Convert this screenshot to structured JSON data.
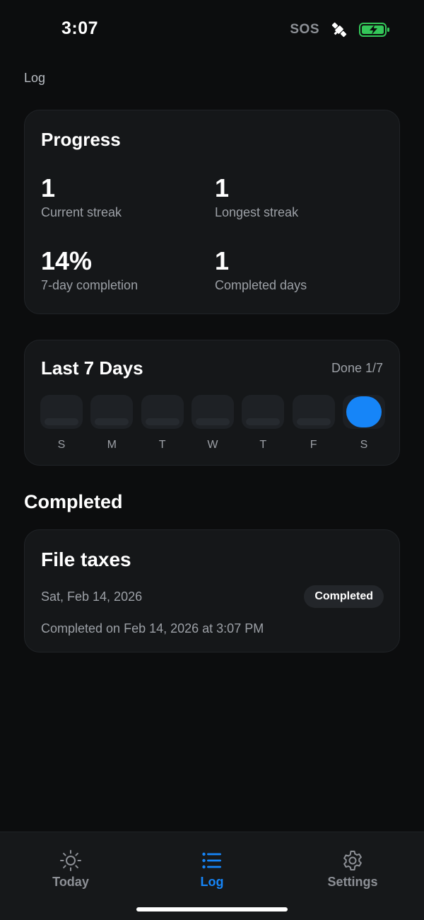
{
  "status_bar": {
    "time": "3:07",
    "sos": "SOS"
  },
  "nav": {
    "title": "Log"
  },
  "progress": {
    "title": "Progress",
    "stats": [
      {
        "value": "1",
        "label": "Current streak"
      },
      {
        "value": "1",
        "label": "Longest streak"
      },
      {
        "value": "14%",
        "label": "7-day completion"
      },
      {
        "value": "1",
        "label": "Completed days"
      }
    ]
  },
  "week": {
    "title": "Last 7 Days",
    "done_count": "Done 1/7",
    "days": [
      {
        "label": "S",
        "done": false
      },
      {
        "label": "M",
        "done": false
      },
      {
        "label": "T",
        "done": false
      },
      {
        "label": "W",
        "done": false
      },
      {
        "label": "T",
        "done": false
      },
      {
        "label": "F",
        "done": false
      },
      {
        "label": "S",
        "done": true
      }
    ]
  },
  "completed": {
    "section_title": "Completed",
    "items": [
      {
        "title": "File taxes",
        "date": "Sat, Feb 14, 2026",
        "badge": "Completed",
        "note": "Completed on Feb 14, 2026 at 3:07 PM"
      }
    ]
  },
  "tabs": [
    {
      "label": "Today",
      "icon": "sun-icon",
      "active": false
    },
    {
      "label": "Log",
      "icon": "list-icon",
      "active": true
    },
    {
      "label": "Settings",
      "icon": "gear-icon",
      "active": false
    }
  ],
  "colors": {
    "accent": "#1685f8",
    "background": "#0c0d0e",
    "card": "#151719"
  }
}
